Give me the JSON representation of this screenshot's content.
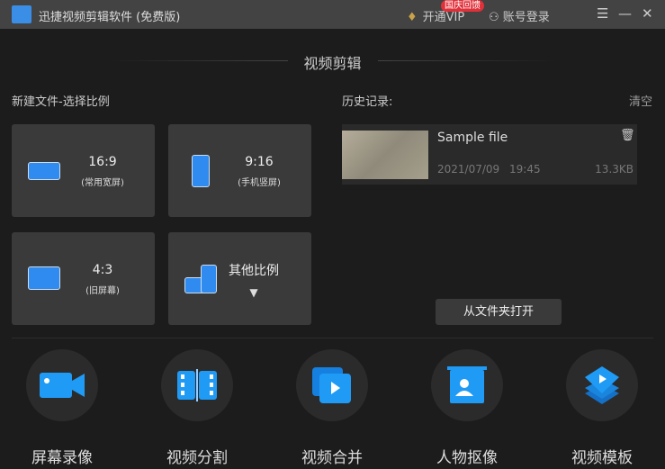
{
  "titlebar": {
    "title": "迅捷视频剪辑软件 (免费版)",
    "vip": "开通VIP",
    "badge": "国庆回馈",
    "login": "账号登录",
    "menu": "☰",
    "minimize": "—",
    "close": "✕"
  },
  "heading": "视频剪辑",
  "new_file": {
    "label": "新建文件-选择比例",
    "cards": [
      {
        "ratio": "16:9",
        "sub": "(常用宽屏)"
      },
      {
        "ratio": "9:16",
        "sub": "(手机竖屏)"
      },
      {
        "ratio": "4:3",
        "sub": "(旧屏幕)"
      },
      {
        "ratio": "其他比例",
        "sub": "▼"
      }
    ]
  },
  "history": {
    "label": "历史记录:",
    "clear": "清空",
    "items": [
      {
        "name": "Sample file",
        "date": "2021/07/09",
        "time": "19:45",
        "size": "13.3KB"
      }
    ],
    "open_button": "从文件夹打开"
  },
  "tools": [
    {
      "label": "屏幕录像",
      "icon": "camera-icon"
    },
    {
      "label": "视频分割",
      "icon": "split-icon"
    },
    {
      "label": "视频合并",
      "icon": "merge-icon"
    },
    {
      "label": "人物抠像",
      "icon": "portrait-icon"
    },
    {
      "label": "视频模板",
      "icon": "template-icon"
    }
  ],
  "colors": {
    "accent": "#2f8bf0",
    "badge": "#e0303a"
  }
}
